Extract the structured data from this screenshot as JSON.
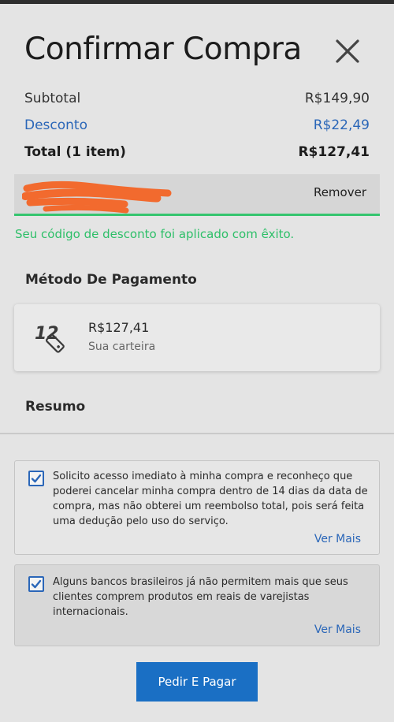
{
  "header": {
    "title": "Confirmar Compra",
    "close_icon": "close-icon"
  },
  "summary_lines": {
    "subtotal_label": "Subtotal",
    "subtotal_value": "R$149,90",
    "discount_label": "Desconto",
    "discount_value": "R$22,49",
    "total_label": "Total (1 item)",
    "total_value": "R$127,41"
  },
  "promo": {
    "code": "",
    "remove_label": "Remover",
    "success_message": "Seu código de desconto foi aplicado com êxito."
  },
  "payment": {
    "heading": "Método De Pagamento",
    "amount": "R$127,41",
    "source": "Sua carteira",
    "icon": "wallet-funds-icon"
  },
  "summary_section": {
    "heading": "Resumo"
  },
  "consents": [
    {
      "checked": true,
      "text": "Solicito acesso imediato à minha compra e reconheço que poderei cancelar minha compra dentro de 14 dias da data de compra, mas não obterei um reembolso total, pois será feita uma dedução pelo uso do serviço.",
      "more_label": "Ver Mais"
    },
    {
      "checked": true,
      "text": "Alguns bancos brasileiros já não permitem mais que seus clientes comprem produtos em reais de varejistas internacionais.",
      "more_label": "Ver Mais"
    }
  ],
  "actions": {
    "pay_label": "Pedir E Pagar"
  },
  "colors": {
    "accent": "#1a6fc4",
    "link": "#2a66b8",
    "success": "#2dbf68",
    "background": "#e4e4e4"
  }
}
